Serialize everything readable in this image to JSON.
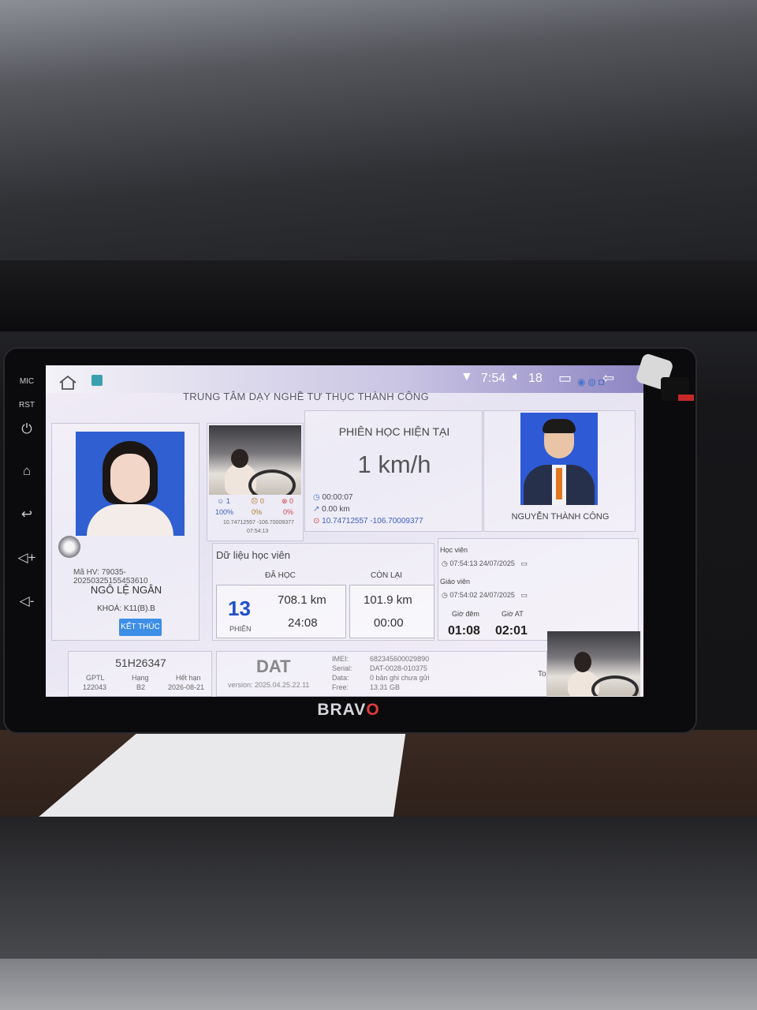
{
  "statusbar": {
    "time": "7:54",
    "volume_level": "18"
  },
  "header": {
    "title": "TRUNG TÂM DẠY NGHỀ TƯ THỤC THÀNH CÔNG"
  },
  "side_buttons": {
    "mic": "MIC",
    "rst": "RST"
  },
  "student": {
    "ma_hv": "Mã HV: 79035-20250325155453610",
    "name": "NGÔ LỆ NGÂN",
    "khoa": "KHOÁ: K11(B).B",
    "end_button": "KẾT THÚC"
  },
  "camera1": {
    "stat1_value": "1",
    "stat1_pct": "100%",
    "stat2_value": "0",
    "stat2_pct": "0%",
    "stat3_value": "0",
    "stat3_pct": "0%",
    "coords": "10.74712557 -106.70009377",
    "time": "07:54:13"
  },
  "session": {
    "title": "PHIÊN HỌC HIỆN TẠI",
    "speed": "1 km/h",
    "duration": "00:00:07",
    "distance": "0.00 km",
    "gps": "10.74712557 -106.70009377"
  },
  "teacher": {
    "name": "NGUYỄN THÀNH CÔNG"
  },
  "student_data": {
    "title": "Dữ liệu học viên",
    "dahoc_label": "ĐÃ HỌC",
    "conlai_label": "CÒN LẠI",
    "phien_count": "13",
    "phien_label": "PHIÊN",
    "dahoc_km": "708.1 km",
    "dahoc_time": "24:08",
    "conlai_km": "101.9 km",
    "conlai_time": "00:00"
  },
  "times": {
    "hocvien_label": "Học viên",
    "hocvien_time": "07:54:13 24/07/2025",
    "giaovien_label": "Giáo viên",
    "giaovien_time": "07:54:02 24/07/2025",
    "gio_dem_label": "Giờ đêm",
    "gio_dem_value": "01:08",
    "gio_at_label": "Giờ AT",
    "gio_at_value": "02:01"
  },
  "vehicle": {
    "plate": "51H26347",
    "gptl_label": "GPTL",
    "gptl_value": "122043",
    "hang_label": "Hạng",
    "hang_value": "B2",
    "hethan_label": "Hết hạn",
    "hethan_value": "2026-08-21"
  },
  "device": {
    "name": "DAT",
    "version": "version: 2025.04.25.22.11",
    "imei_label": "IMEI:",
    "imei_value": "682345600029890",
    "serial_label": "Serial:",
    "serial_value": "DAT-0028-010375",
    "data_label": "Data:",
    "data_value": "0 bản ghi chưa gửi",
    "free_label": "Free:",
    "free_value": "13.31 GB"
  },
  "camera2": {
    "label": "To"
  },
  "bezel": {
    "brand_prefix": "BRA",
    "brand_v": "V",
    "brand_o": "O"
  },
  "icons": [
    "wifi-icon",
    "volume-icon",
    "recent-apps-icon",
    "back-icon",
    "home-icon",
    "power-icon",
    "volume-up-icon",
    "volume-down-icon"
  ]
}
